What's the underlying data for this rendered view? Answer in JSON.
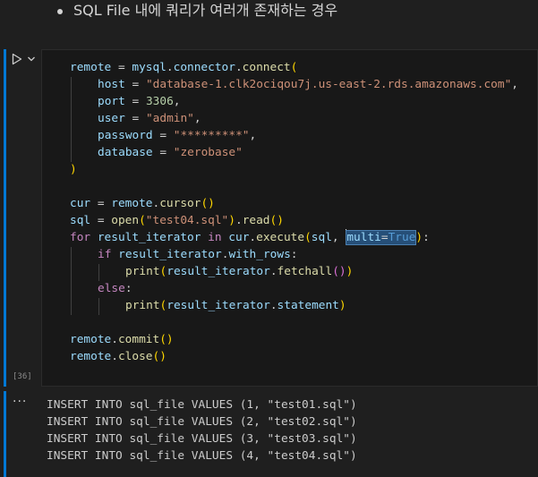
{
  "markdown": {
    "bullet_text": "SQL File 내에 쿼리가 여러개 존재하는 경우"
  },
  "cell": {
    "execution_count": "[36]",
    "run_icon": "run-triangle-icon",
    "options_icon": "chevron-down-icon"
  },
  "code": {
    "l1": {
      "a": "remote",
      "b": " = ",
      "c": "mysql",
      "d": ".",
      "e": "connector",
      "f": ".",
      "g": "connect",
      "h": "("
    },
    "l2": {
      "a": "host",
      "b": " = ",
      "c": "\"database-1.clk2ociqou7j.us-east-2.rds.amazonaws.com\"",
      "d": ","
    },
    "l3": {
      "a": "port",
      "b": " = ",
      "c": "3306",
      "d": ","
    },
    "l4": {
      "a": "user",
      "b": " = ",
      "c": "\"admin\"",
      "d": ","
    },
    "l5": {
      "a": "password",
      "b": " = ",
      "c": "\"*********\"",
      "d": ","
    },
    "l6": {
      "a": "database",
      "b": " = ",
      "c": "\"zerobase\""
    },
    "l7": {
      "a": ")"
    },
    "l9": {
      "a": "cur",
      "b": " = ",
      "c": "remote",
      "d": ".",
      "e": "cursor",
      "f": "()"
    },
    "l10": {
      "a": "sql",
      "b": " = ",
      "c": "open",
      "d": "(",
      "e": "\"test04.sql\"",
      "f": ")",
      "g": ".",
      "h": "read",
      "i": "()"
    },
    "l11": {
      "a": "for",
      "b": " ",
      "c": "result_iterator",
      "d": " ",
      "e": "in",
      "f": " ",
      "g": "cur",
      "h": ".",
      "i": "execute",
      "j": "(",
      "k": "sql",
      "l": ", ",
      "m": "multi",
      "n": "=",
      "o": "True",
      "p": ")",
      "q": ":"
    },
    "l12": {
      "a": "if",
      "b": " ",
      "c": "result_iterator",
      "d": ".",
      "e": "with_rows",
      "f": ":"
    },
    "l13": {
      "a": "print",
      "b": "(",
      "c": "result_iterator",
      "d": ".",
      "e": "fetchall",
      "f": "()",
      "g": ")"
    },
    "l14": {
      "a": "else",
      "b": ":"
    },
    "l15": {
      "a": "print",
      "b": "(",
      "c": "result_iterator",
      "d": ".",
      "e": "statement",
      "f": ")"
    },
    "l17": {
      "a": "remote",
      "b": ".",
      "c": "commit",
      "d": "()"
    },
    "l18": {
      "a": "remote",
      "b": ".",
      "c": "close",
      "d": "()"
    }
  },
  "output": {
    "menu_label": "···",
    "lines": [
      "INSERT INTO sql_file VALUES (1, \"test01.sql\")",
      "INSERT INTO sql_file VALUES (2, \"test02.sql\")",
      "INSERT INTO sql_file VALUES (3, \"test03.sql\")",
      "INSERT INTO sql_file VALUES (4, \"test04.sql\")"
    ]
  },
  "colors": {
    "accent": "#0078d4",
    "background": "#1f1f1f",
    "editor_background": "#181818",
    "selection": "#264f78"
  }
}
